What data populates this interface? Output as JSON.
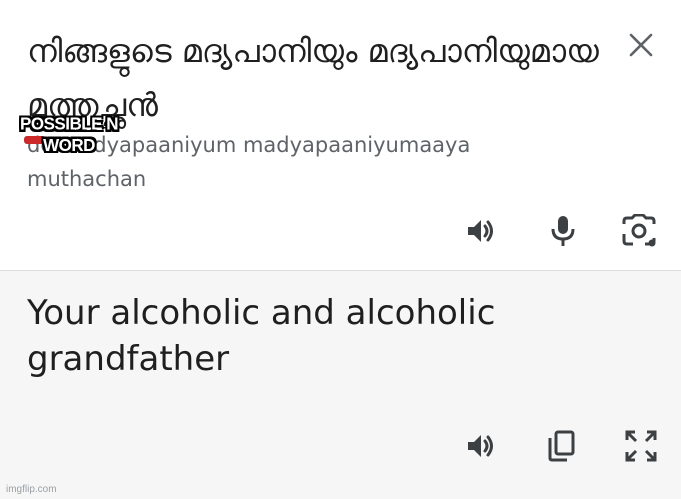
{
  "source": {
    "text": "നിങ്ങളുടെ മദ്യപാനിയും മദ്യപാനിയുമായ മുത്തച്ഛൻ",
    "transliteration": "de madyapaaniyum madyapaaniyumaaya muthachan"
  },
  "overlay": {
    "caption": "POSSIBLE N WORD"
  },
  "translation": {
    "text": "Your alcoholic and alcoholic grandfather"
  },
  "watermark": "imgflip.com",
  "colors": {
    "icon": "#3c4043",
    "translation_bg": "#f6f6f6",
    "caption_fill": "#ffffff",
    "caption_stroke": "#000000"
  }
}
